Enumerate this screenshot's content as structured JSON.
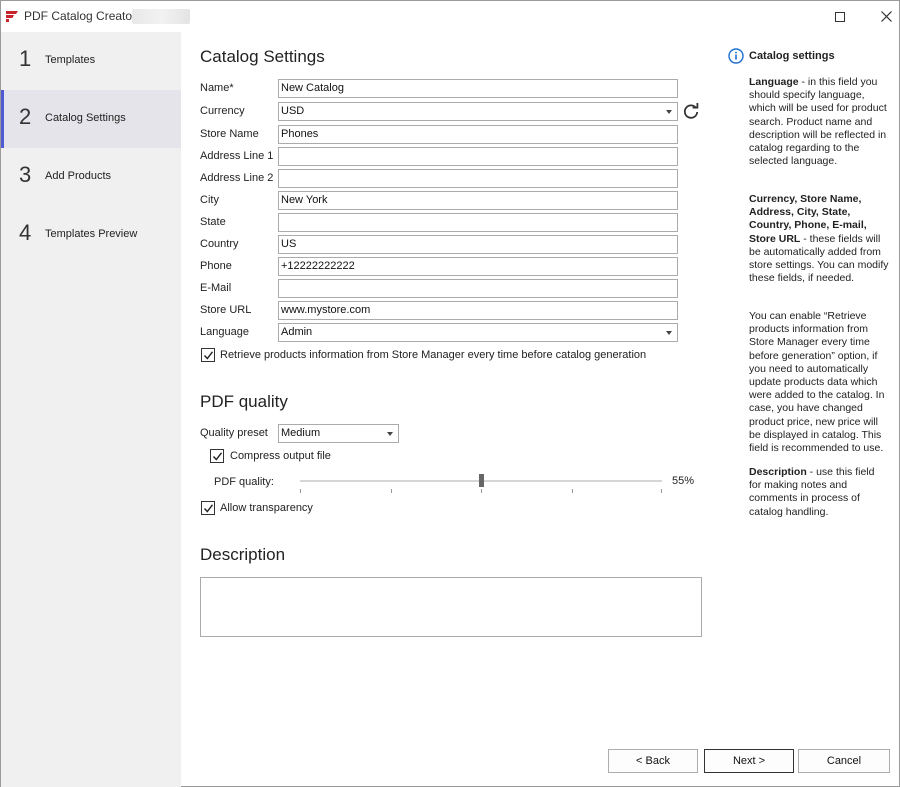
{
  "window": {
    "title": "PDF Catalog Creator",
    "maximize_icon": "maximize-icon",
    "close_icon": "close-icon"
  },
  "colors": {
    "accent": "#4f5bd5",
    "logo": "#c8232c",
    "sidebar_bg": "#f0f0f0",
    "info": "#1f6fd1"
  },
  "sidebar": {
    "steps": [
      {
        "num": "1",
        "label": "Templates"
      },
      {
        "num": "2",
        "label": "Catalog Settings"
      },
      {
        "num": "3",
        "label": "Add Products"
      },
      {
        "num": "4",
        "label": "Templates Preview"
      }
    ]
  },
  "catalog": {
    "title": "Catalog Settings",
    "fields": {
      "name": {
        "label": "Name*",
        "value": "New Catalog"
      },
      "currency": {
        "label": "Currency",
        "value": "USD"
      },
      "store_name": {
        "label": "Store Name",
        "value": "Phones"
      },
      "address1": {
        "label": "Address Line 1",
        "value": ""
      },
      "address2": {
        "label": "Address Line 2",
        "value": ""
      },
      "city": {
        "label": "City",
        "value": "New York"
      },
      "state": {
        "label": "State",
        "value": ""
      },
      "country": {
        "label": "Country",
        "value": "US"
      },
      "phone": {
        "label": "Phone",
        "value": "+12222222222"
      },
      "email": {
        "label": "E-Mail",
        "value": ""
      },
      "store_url": {
        "label": "Store URL",
        "value": "www.mystore.com"
      },
      "language": {
        "label": "Language",
        "value": "Admin"
      }
    },
    "retrieve_label": "Retrieve products information from Store Manager every time before catalog generation",
    "retrieve_checked": true
  },
  "pdf": {
    "title": "PDF quality",
    "preset_label": "Quality preset",
    "preset_value": "Medium",
    "compress_label": "Compress output file",
    "compress_checked": true,
    "quality_label": "PDF quality:",
    "quality_value": 55,
    "quality_text": "55%",
    "transparency_label": "Allow transparency",
    "transparency_checked": true
  },
  "description": {
    "title": "Description",
    "value": ""
  },
  "help": {
    "title": "Catalog settings",
    "p1_bold": "Language",
    "p1_text": " - in this field you should specify language, which will be used for product search. Product name and description will be reflected in catalog regarding to the selected language.",
    "p2_bold": "Currency, Store Name, Address, City, State, Country, Phone, E-mail, Store URL",
    "p2_text": " - these fields will be automatically added from store settings. You can modify these fields, if needed.",
    "p3_text": "You can enable “Retrieve products information from Store Manager every time before generation” option, if you need to automatically update products data which were added to the catalog. In case, you have changed product price, new price will be displayed in catalog. This field is recommended to use.",
    "p4_bold": "Description",
    "p4_text": " - use this field for making notes and comments in process of catalog handling."
  },
  "buttons": {
    "back": "< Back",
    "next": "Next >",
    "cancel": "Cancel"
  }
}
